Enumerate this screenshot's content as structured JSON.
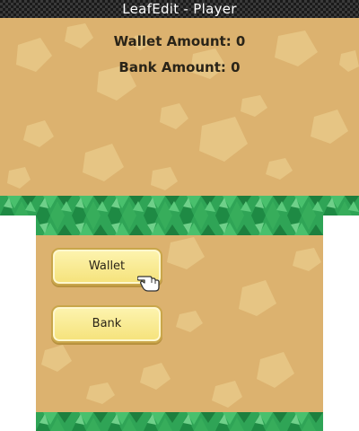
{
  "window": {
    "title": "LeafEdit - Player"
  },
  "info": {
    "wallet_line": "Wallet Amount: 0",
    "bank_line": "Bank Amount: 0"
  },
  "buttons": {
    "wallet_label": "Wallet",
    "bank_label": "Bank"
  },
  "icons": {
    "cursor": "pointing-hand-icon"
  },
  "colors": {
    "sand": "#dcb26f",
    "pebble": "#e6c584",
    "grass": "#2fa456",
    "button_fill": "#f8e68a",
    "button_border": "#c9a64a",
    "title_bar": "#1a1a1a"
  }
}
